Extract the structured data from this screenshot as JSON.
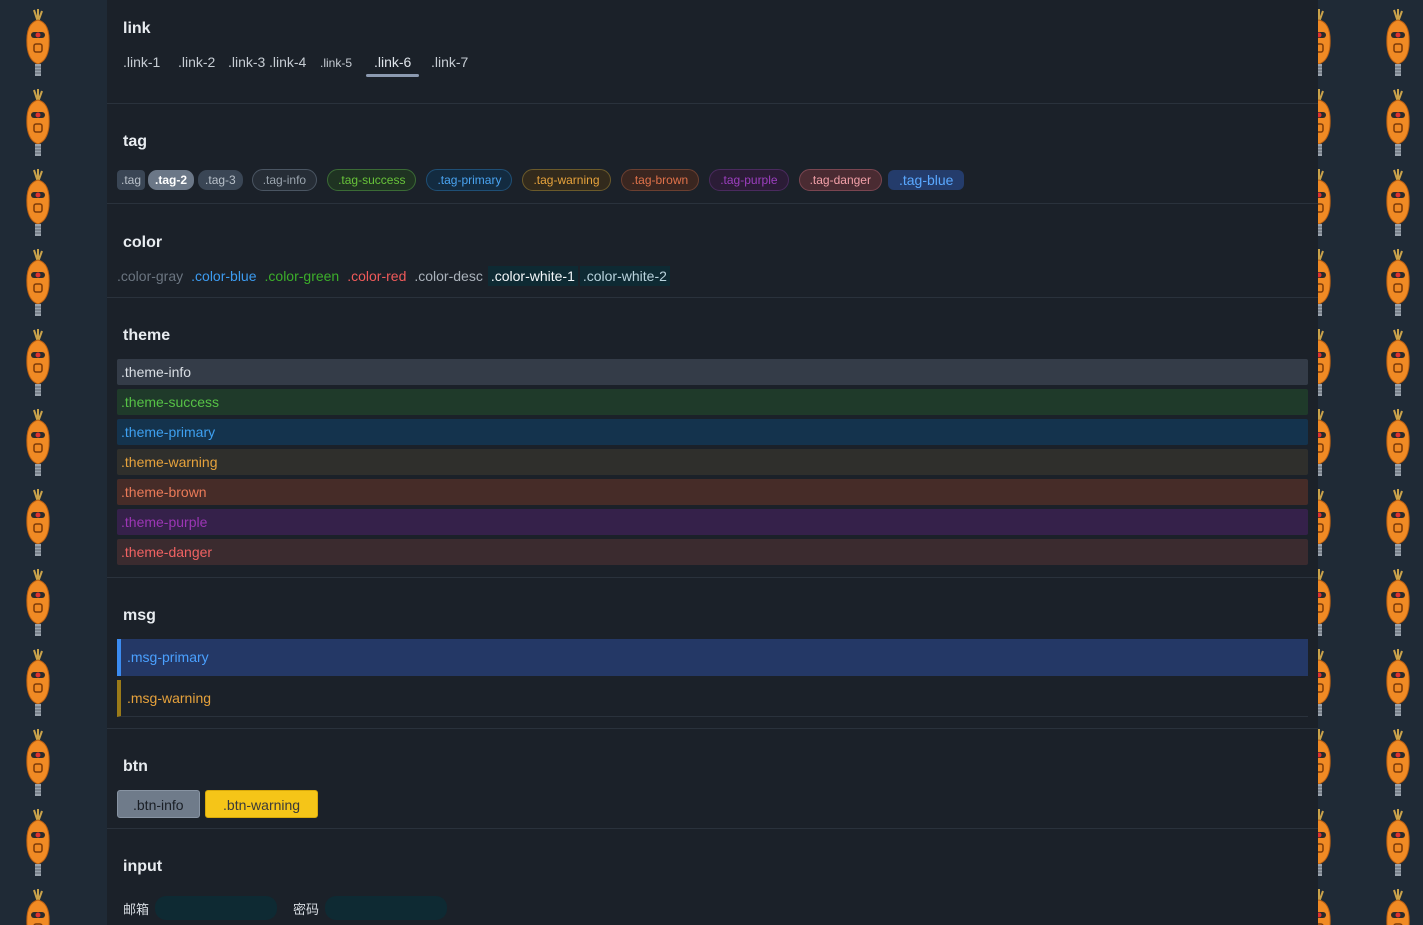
{
  "sections": {
    "link": {
      "title": "link",
      "items": [
        ".link-1",
        ".link-2",
        ".link-3",
        ".link-4",
        ".link-5",
        ".link-6",
        ".link-7"
      ],
      "active_index": 5
    },
    "tag": {
      "title": "tag",
      "items": [
        ".tag",
        ".tag-2",
        ".tag-3",
        ".tag-info",
        ".tag-success",
        ".tag-primary",
        ".tag-warning",
        ".tag-brown",
        ".tag-purple",
        ".tag-danger",
        ".tag-blue"
      ]
    },
    "color": {
      "title": "color",
      "items": [
        ".color-gray",
        ".color-blue",
        ".color-green",
        ".color-red",
        ".color-desc",
        ".color-white-1",
        ".color-white-2"
      ]
    },
    "theme": {
      "title": "theme",
      "items": [
        ".theme-info",
        ".theme-success",
        ".theme-primary",
        ".theme-warning",
        ".theme-brown",
        ".theme-purple",
        ".theme-danger"
      ]
    },
    "msg": {
      "title": "msg",
      "items": [
        ".msg-primary",
        ".msg-warning"
      ]
    },
    "btn": {
      "title": "btn",
      "items": [
        ".btn-info",
        ".btn-warning"
      ]
    },
    "input": {
      "title": "input",
      "email_label": "邮箱",
      "email_value": "",
      "password_label": "密码",
      "password_value": ""
    }
  },
  "colors": {
    "page_bg": "#1f2a36",
    "panel_bg": "#1b2129",
    "blue": "#4a9eff",
    "green": "#52c41a",
    "red": "#ff5c5c",
    "warning": "#e6a23c",
    "purple": "#9c27b0",
    "btn_warning_bg": "#f5c518"
  },
  "background_icon": "carrot-robot-icon"
}
